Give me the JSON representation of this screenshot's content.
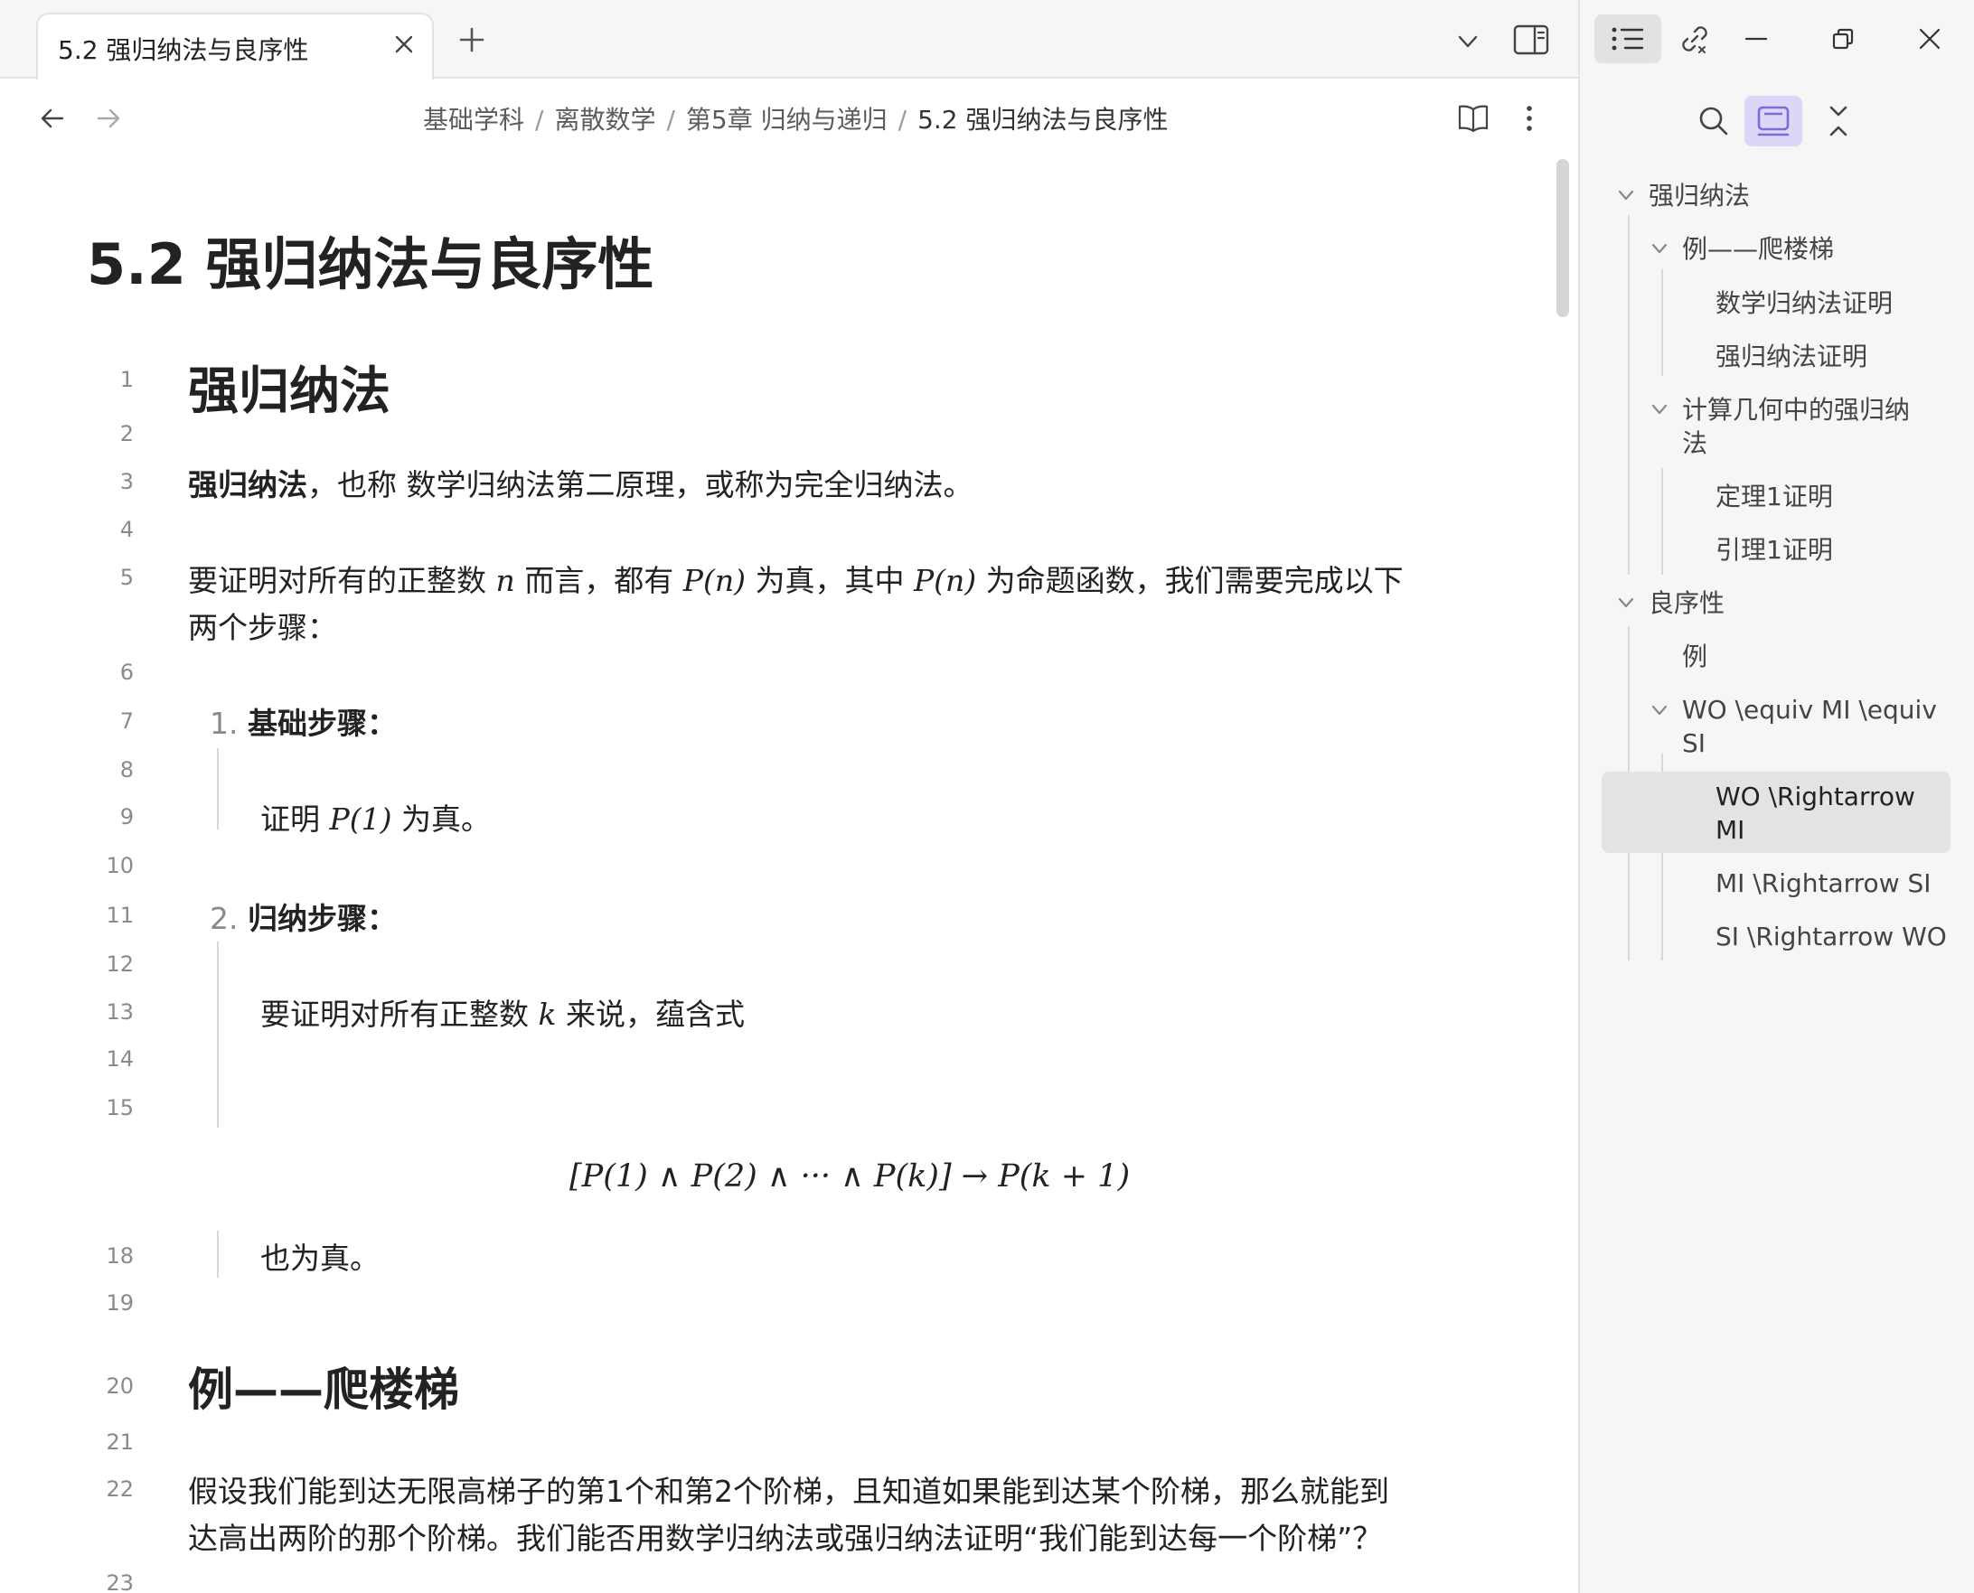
{
  "tab": {
    "title": "5.2 强归纳法与良序性"
  },
  "breadcrumb": {
    "items": [
      "基础学科",
      "离散数学",
      "第5章 归纳与递归"
    ],
    "current": "5.2 强归纳法与良序性",
    "separator": "/"
  },
  "doc": {
    "title": "5.2 强归纳法与良序性",
    "line_numbers": [
      "1",
      "2",
      "3",
      "4",
      "5",
      "6",
      "7",
      "8",
      "9",
      "10",
      "11",
      "12",
      "13",
      "14",
      "15",
      "18",
      "19",
      "20",
      "21",
      "22",
      "23"
    ],
    "h_strong_induction": "强归纳法",
    "p3_bold": "强归纳法",
    "p3_rest": "，也称 数学归纳法第二原理，或称为完全归纳法。",
    "p5_a": "要证明对所有的正整数 ",
    "p5_n": "n",
    "p5_b": " 而言，都有 ",
    "p5_Pn1": "P(n)",
    "p5_c": " 为真，其中 ",
    "p5_Pn2": "P(n)",
    "p5_d": " 为命题函数，我们需要完成以下",
    "p5_line2": "两个步骤：",
    "step1_num": "1.",
    "step1_label": "基础步骤：",
    "step1_text_a": "证明 ",
    "step1_math": "P(1)",
    "step1_text_b": " 为真。",
    "step2_num": "2.",
    "step2_label": "归纳步骤：",
    "step2_text_a": "要证明对所有正整数 ",
    "step2_k": "k",
    "step2_text_b": " 来说，蕴含式",
    "display_math": "[P(1) ∧ P(2) ∧ ··· ∧ P(k)] → P(k + 1)",
    "step2_end": "也为真。",
    "h_example": "例——爬楼梯",
    "p22_line1": "假设我们能到达无限高梯子的第1个和第2个阶梯，且知道如果能到达某个阶梯，那么就能到",
    "p22_line2": "达高出两阶的那个阶梯。我们能否用数学归纳法或强归纳法证明“我们能到达每一个阶梯”？"
  },
  "outline": {
    "items": [
      {
        "label": "强归纳法",
        "level": 0,
        "collapsible": true
      },
      {
        "label": "例——爬楼梯",
        "level": 1,
        "collapsible": true
      },
      {
        "label": "数学归纳法证明",
        "level": 2,
        "collapsible": false
      },
      {
        "label": "强归纳法证明",
        "level": 2,
        "collapsible": false
      },
      {
        "label": "计算几何中的强归纳",
        "label2": "法",
        "level": 1,
        "collapsible": true
      },
      {
        "label": "定理1证明",
        "level": 2,
        "collapsible": false
      },
      {
        "label": "引理1证明",
        "level": 2,
        "collapsible": false
      },
      {
        "label": "良序性",
        "level": 0,
        "collapsible": true
      },
      {
        "label": "例",
        "level": 1,
        "collapsible": false
      },
      {
        "label": "WO \\equiv MI \\equiv",
        "label2": "SI",
        "level": 1,
        "collapsible": true
      },
      {
        "label": "WO \\Rightarrow",
        "label2": "MI",
        "level": 2,
        "collapsible": false,
        "selected": true
      },
      {
        "label": "MI \\Rightarrow SI",
        "level": 2,
        "collapsible": false
      },
      {
        "label": "SI \\Rightarrow WO",
        "level": 2,
        "collapsible": false
      }
    ]
  },
  "icons": {
    "tab_close": "close-icon",
    "tab_new": "plus-icon",
    "tab_list": "chevron-down-icon",
    "sidebar_toggle": "sidebar-toggle-icon",
    "back": "arrow-left-icon",
    "forward": "arrow-right-icon",
    "reading_view": "book-open-icon",
    "more": "more-vertical-icon",
    "outline": "list-icon",
    "backlinks": "link-icon",
    "minimize": "minimize-icon",
    "restore": "restore-icon",
    "close_window": "close-window-icon",
    "search": "search-icon",
    "show_in_page": "frame-icon",
    "collapse_all": "collapse-icon"
  },
  "colors": {
    "accent": "#7b6cd9",
    "accent_bg": "#dcd7f6",
    "selected_bg": "#e3e3e3"
  }
}
